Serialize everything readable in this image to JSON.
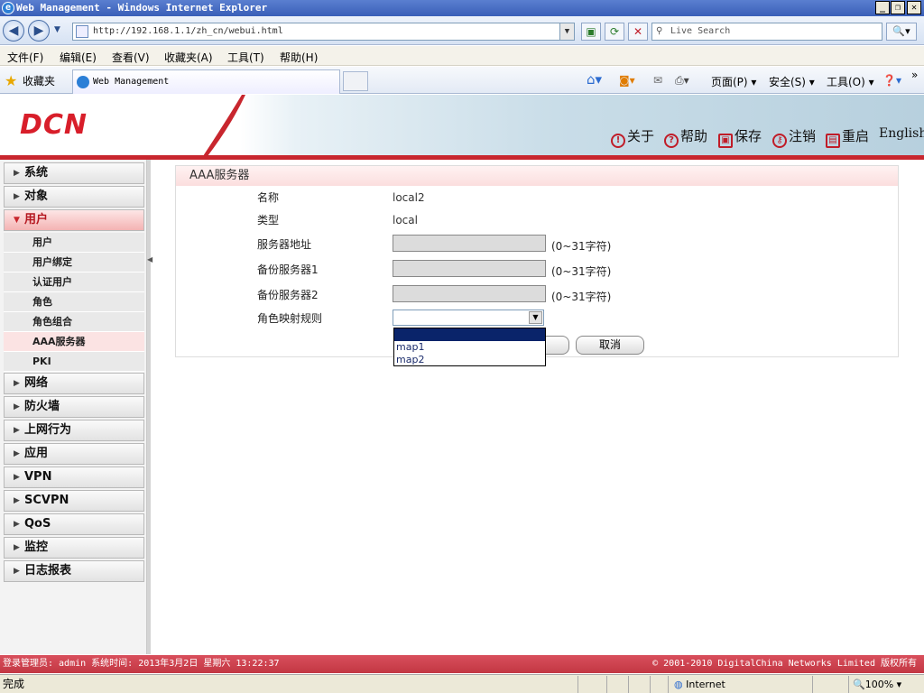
{
  "window": {
    "title": "Web Management - Windows Internet Explorer",
    "buttons": [
      "_",
      "❐",
      "✕"
    ]
  },
  "addressbar": {
    "url": "http://192.168.1.1/zh_cn/webui.html",
    "search_placeholder": "Live Search"
  },
  "menu": [
    "文件(F)",
    "编辑(E)",
    "查看(V)",
    "收藏夹(A)",
    "工具(T)",
    "帮助(H)"
  ],
  "favorites": {
    "label": "收藏夹",
    "tab_title": "Web Management"
  },
  "commandbar": {
    "page": "页面(P)",
    "safety": "安全(S)",
    "tools": "工具(O)"
  },
  "header": {
    "logo": "DCN",
    "links": {
      "about": "关于",
      "help": "帮助",
      "save": "保存",
      "logout": "注销",
      "reboot": "重启",
      "language": "English"
    }
  },
  "sidebar": {
    "groups_top": [
      "系统",
      "对象"
    ],
    "active_group": "用户",
    "sub_items": [
      "用户",
      "用户绑定",
      "认证用户",
      "角色",
      "角色组合",
      "AAA服务器",
      "PKI"
    ],
    "selected_sub": "AAA服务器",
    "groups_bottom": [
      "网络",
      "防火墙",
      "上网行为",
      "应用",
      "VPN",
      "SCVPN",
      "QoS",
      "监控",
      "日志报表"
    ]
  },
  "panel": {
    "title": "AAA服务器",
    "fields": {
      "name_label": "名称",
      "name_value": "local2",
      "type_label": "类型",
      "type_value": "local",
      "server_label": "服务器地址",
      "backup1_label": "备份服务器1",
      "backup2_label": "备份服务器2",
      "hint": "(0~31字符)",
      "role_map_label": "角色映射规则"
    },
    "dropdown_options": [
      "",
      "map1",
      "map2"
    ],
    "cancel_label": "取消"
  },
  "footer": {
    "left": "登录管理员: admin 系统时间: 2013年3月2日 星期六 13:22:37",
    "right": "© 2001-2010 DigitalChina Networks Limited 版权所有"
  },
  "statusbar": {
    "done": "完成",
    "zone": "Internet",
    "zoom": "100%"
  }
}
